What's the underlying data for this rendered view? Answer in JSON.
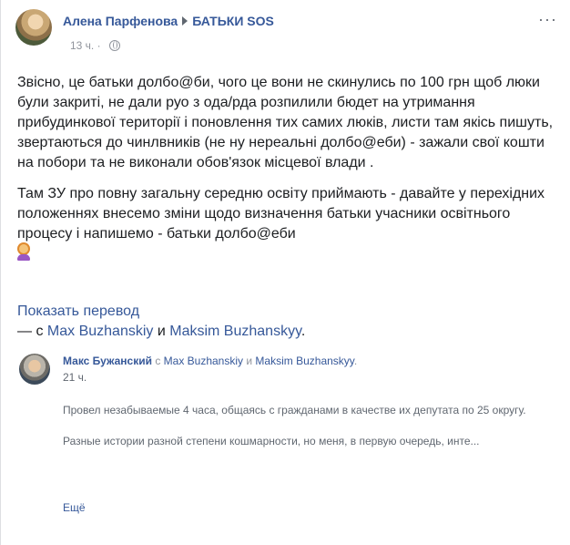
{
  "post": {
    "author": "Алена Парфенова",
    "group": "БАТЬКИ SOS",
    "timestamp": "13 ч.",
    "privacy_icon": "globe-icon",
    "menu_icon": "more-dots-icon",
    "paragraphs": [
      "Звісно, це батьки долбо@би, чого це вони не скинулись по 100 грн щоб люки були закриті, не дали руо з ода/рда розпилили бюдет на утримання прибудинкової території і поновлення тих самих люків, листи там якісь пишуть, звертаються до чинлвників (не ну нереальні долбо@еби) - зажали свої кошти на побори та не виконали обов'язок місцевої влади .",
      "Там ЗУ про повну загальну середню освіту приймають - давайте у перехідних положеннях внесемо зміни щодо визначення батьки учасники освітнього процесу і напишемо - батьки долбо@еби"
    ],
    "emoji_icon": "person-shrugging-emoji",
    "translate_label": "Показать перевод",
    "with_prefix": "— с",
    "tagged": [
      "Max Buzhanskiy",
      "Maksim Buzhanskyy"
    ],
    "and_word": "и",
    "period": "."
  },
  "shared": {
    "author": "Макс Бужанский",
    "with_word": "с",
    "tagged": [
      "Max Buzhanskiy",
      "Maksim Buzhanskyy"
    ],
    "and_word": "и",
    "period": ".",
    "timestamp": "21 ч.",
    "paragraphs": [
      "Провел незабываемые 4 часа, общаясь с гражданами в качестве их депутата по 25 округу.",
      "Разные истории разной степени кошмарности, но меня, в первую очередь, инте..."
    ],
    "more_label": "Ещё"
  },
  "colors": {
    "link": "#365899",
    "text": "#1c1e21",
    "meta": "#90949c",
    "muted": "#606770"
  }
}
